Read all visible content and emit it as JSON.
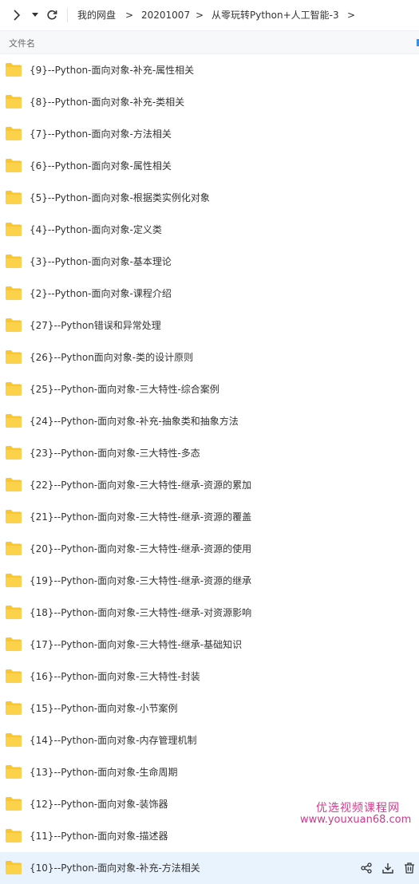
{
  "toolbar": {
    "forward_icon": "chevron-right-icon",
    "dropdown_icon": "caret-down-icon",
    "refresh_icon": "refresh-icon",
    "breadcrumbs": [
      "我的网盘",
      "20201007",
      "从零玩转Python+人工智能-3"
    ],
    "separator": ">"
  },
  "table": {
    "column_name": "文件名"
  },
  "files": [
    "{9}--Python-面向对象-补充-属性相关",
    "{8}--Python-面向对象-补充-类相关",
    "{7}--Python-面向对象-方法相关",
    "{6}--Python-面向对象-属性相关",
    "{5}--Python-面向对象-根据类实例化对象",
    "{4}--Python-面向对象-定义类",
    "{3}--Python-面向对象-基本理论",
    "{2}--Python-面向对象-课程介绍",
    "{27}--Python错误和异常处理",
    "{26}--Python面向对象-类的设计原则",
    "{25}--Python-面向对象-三大特性-综合案例",
    "{24}--Python-面向对象-补充-抽象类和抽象方法",
    "{23}--Python-面向对象-三大特性-多态",
    "{22}--Python-面向对象-三大特性-继承-资源的累加",
    "{21}--Python-面向对象-三大特性-继承-资源的覆盖",
    "{20}--Python-面向对象-三大特性-继承-资源的使用",
    "{19}--Python-面向对象-三大特性-继承-资源的继承",
    "{18}--Python-面向对象-三大特性-继承-对资源影响",
    "{17}--Python-面向对象-三大特性-继承-基础知识",
    "{16}--Python-面向对象-三大特性-封装",
    "{15}--Python-面向对象-小节案例",
    "{14}--Python-面向对象-内存管理机制",
    "{13}--Python-面向对象-生命周期",
    "{12}--Python-面向对象-装饰器",
    "{11}--Python-面向对象-描述器",
    "{10}--Python-面向对象-补充-方法相关"
  ],
  "selected_index": 25,
  "row_actions": [
    "share-icon",
    "download-icon",
    "delete-icon"
  ],
  "watermark": {
    "line1": "优选视频课程网",
    "line2": "www.youxuan68.com"
  },
  "colors": {
    "folder": "#f8c630",
    "selected_row": "#e9f3fe",
    "watermark": "#d43b8d"
  }
}
